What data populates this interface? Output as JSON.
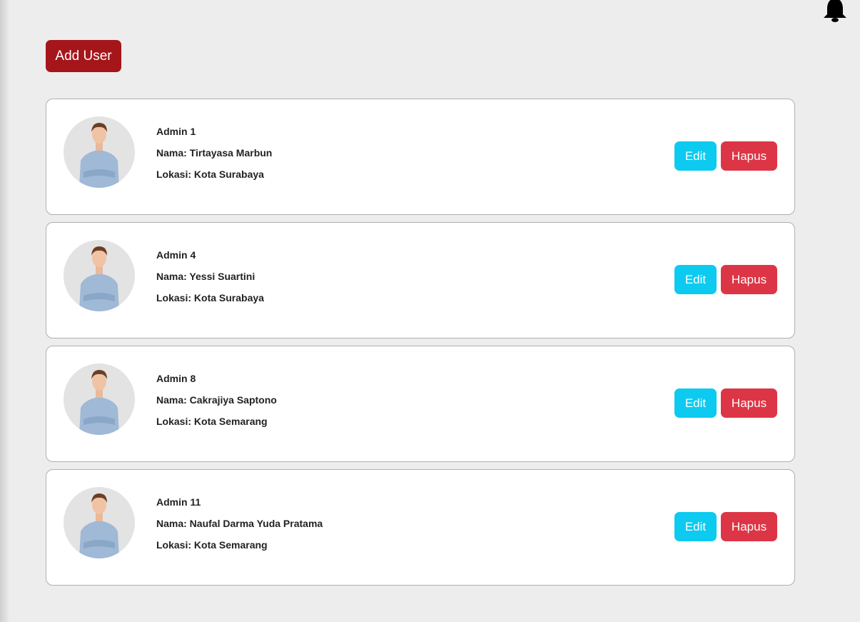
{
  "header": {
    "add_user_label": "Add User",
    "notification_icon": "bell-icon"
  },
  "colors": {
    "add_user": "#a5161b",
    "edit": "#0dcaf0",
    "delete": "#dc3545"
  },
  "users": [
    {
      "title": "Admin 1",
      "name": "Nama: Tirtayasa Marbun",
      "location": "Lokasi: Kota Surabaya",
      "edit_label": "Edit",
      "delete_label": "Hapus"
    },
    {
      "title": "Admin 4",
      "name": "Nama: Yessi Suartini",
      "location": "Lokasi: Kota Surabaya",
      "edit_label": "Edit",
      "delete_label": "Hapus"
    },
    {
      "title": "Admin 8",
      "name": "Nama: Cakrajiya Saptono",
      "location": "Lokasi: Kota Semarang",
      "edit_label": "Edit",
      "delete_label": "Hapus"
    },
    {
      "title": "Admin 11",
      "name": "Nama: Naufal Darma Yuda Pratama",
      "location": "Lokasi: Kota Semarang",
      "edit_label": "Edit",
      "delete_label": "Hapus"
    }
  ]
}
